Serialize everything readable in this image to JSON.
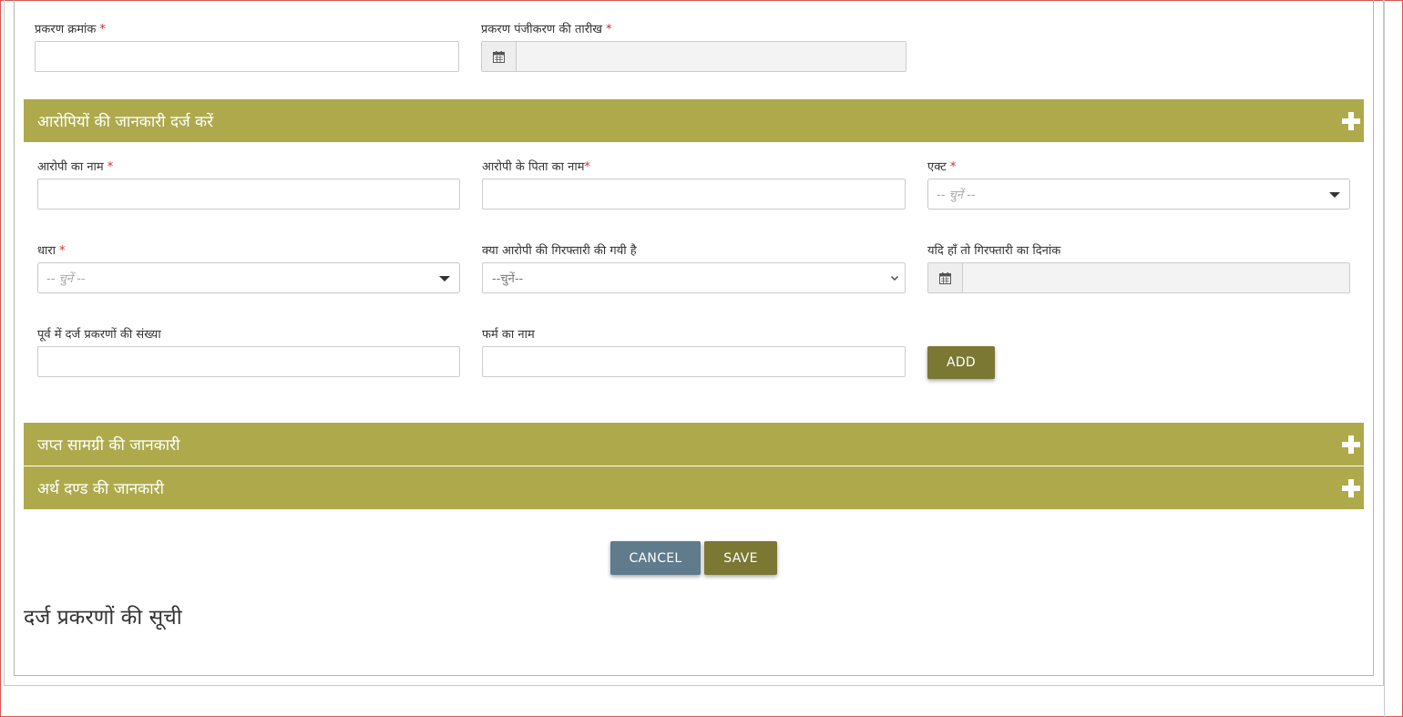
{
  "case_section": {
    "case_number_label": "प्रकरण क्रमांक",
    "case_number_value": "",
    "registration_date_label": "प्रकरण पंजीकरण की तारीख",
    "registration_date_value": "",
    "required_mark": "*"
  },
  "accused_panel": {
    "title": "आरोपियों की जानकारी दर्ज करें",
    "accused_name_label": "आरोपी का नाम",
    "father_name_label": "आरोपी के पिता का नाम",
    "act_label": "एक्ट",
    "act_placeholder": "-- चुनें --",
    "section_label": "धारा",
    "section_placeholder": "-- चुनें --",
    "arrested_label": "क्या आरोपी की गिरफ्तारी की गयी है",
    "arrested_selected": "--चुनें--",
    "arrest_date_label": "यदि हाँ तो गिरफ्तारी का दिनांक",
    "previous_cases_label": "पूर्व में दर्ज प्रकरणों की संख्या",
    "firm_name_label": "फर्म का नाम",
    "add_button": "ADD"
  },
  "seized_panel": {
    "title": "जप्त सामग्री की जानकारी"
  },
  "fine_panel": {
    "title": "अर्थ दण्ड की जानकारी"
  },
  "actions": {
    "cancel": "CANCEL",
    "save": "SAVE"
  },
  "list_title": "दर्ज प्रकरणों की सूची",
  "colors": {
    "panel_header": "#aeaa4c",
    "save_button": "#7a7833",
    "cancel_button": "#5f7b8c",
    "required": "#c9302c"
  },
  "icons": {
    "date_addon": "calendar-icon",
    "panel_toggle": "plus-icon",
    "dropdown": "chevron-down-icon"
  }
}
